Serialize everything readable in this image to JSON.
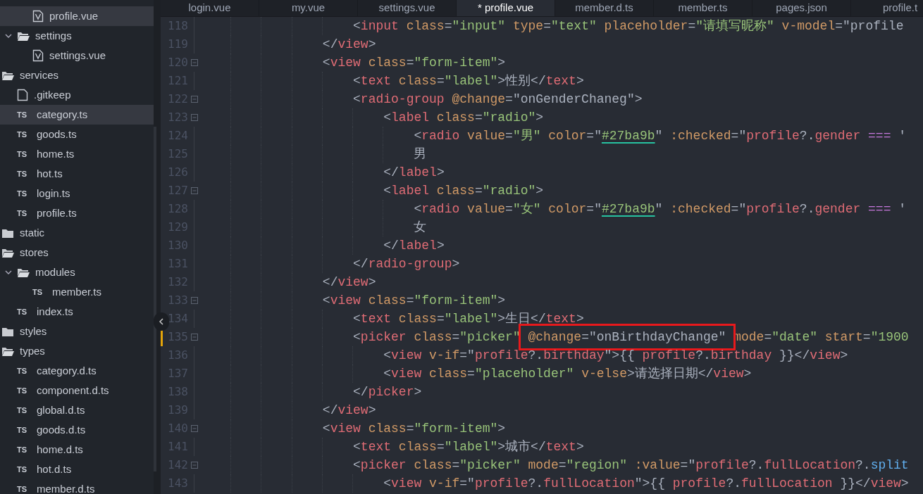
{
  "sidebar": {
    "tree": [
      {
        "kind": "folder",
        "children": [
          {
            "kind": "folder",
            "children": [
              {
                "kind": "vue",
                "name": "profile.vue",
                "selected": true
              }
            ]
          },
          {
            "kind": "folder",
            "name": "settings",
            "expanded": true,
            "children": [
              {
                "kind": "vue",
                "name": "settings.vue",
                "selected": false
              }
            ]
          }
        ]
      },
      {
        "kind": "folder",
        "name": "services",
        "expanded": true,
        "children": [
          {
            "kind": "file",
            "name": ".gitkeep",
            "selected": false
          },
          {
            "kind": "ts",
            "icon_label": "TS",
            "name": "category.ts",
            "selected": true
          },
          {
            "kind": "ts",
            "icon_label": "TS",
            "name": "goods.ts",
            "selected": false
          },
          {
            "kind": "ts",
            "icon_label": "TS",
            "name": "home.ts",
            "selected": false
          },
          {
            "kind": "ts",
            "icon_label": "TS",
            "name": "hot.ts",
            "selected": false
          },
          {
            "kind": "ts",
            "icon_label": "TS",
            "name": "login.ts",
            "selected": false
          },
          {
            "kind": "ts",
            "icon_label": "TS",
            "name": "profile.ts",
            "selected": false
          }
        ]
      },
      {
        "kind": "folder",
        "name": "static",
        "expanded": false
      },
      {
        "kind": "folder",
        "name": "stores",
        "expanded": true,
        "children": [
          {
            "kind": "folder",
            "name": "modules",
            "expanded": true,
            "children": [
              {
                "kind": "ts",
                "icon_label": "TS",
                "name": "member.ts",
                "selected": false
              }
            ]
          },
          {
            "kind": "ts",
            "icon_label": "TS",
            "name": "index.ts",
            "selected": false
          }
        ]
      },
      {
        "kind": "folder",
        "name": "styles",
        "expanded": false
      },
      {
        "kind": "folder",
        "name": "types",
        "expanded": true,
        "children": [
          {
            "kind": "ts",
            "icon_label": "TS",
            "name": "category.d.ts",
            "selected": false
          },
          {
            "kind": "ts",
            "icon_label": "TS",
            "name": "component.d.ts",
            "selected": false
          },
          {
            "kind": "ts",
            "icon_label": "TS",
            "name": "global.d.ts",
            "selected": false
          },
          {
            "kind": "ts",
            "icon_label": "TS",
            "name": "goods.d.ts",
            "selected": false
          },
          {
            "kind": "ts",
            "icon_label": "TS",
            "name": "home.d.ts",
            "selected": false
          },
          {
            "kind": "ts",
            "icon_label": "TS",
            "name": "hot.d.ts",
            "selected": false
          },
          {
            "kind": "ts",
            "icon_label": "TS",
            "name": "member.d.ts",
            "selected": false
          }
        ]
      }
    ]
  },
  "tabs": [
    {
      "label": "login.vue",
      "selected": false
    },
    {
      "label": "my.vue",
      "selected": false
    },
    {
      "label": "settings.vue",
      "selected": false
    },
    {
      "label": "* profile.vue",
      "selected": true
    },
    {
      "label": "member.d.ts",
      "selected": false
    },
    {
      "label": "member.ts",
      "selected": false
    },
    {
      "label": "pages.json",
      "selected": false
    },
    {
      "label": "profile.t",
      "selected": false
    }
  ],
  "editor": {
    "lines": [
      {
        "number": "118",
        "fold": false,
        "tokens": [
          {
            "kind": "p",
            "text": "                    <"
          },
          {
            "kind": "tag",
            "text": "input"
          },
          {
            "kind": "attr",
            "text": " class"
          },
          {
            "kind": "p",
            "text": "="
          },
          {
            "kind": "str",
            "text": "\"input\""
          },
          {
            "kind": "attr",
            "text": " type"
          },
          {
            "kind": "p",
            "text": "="
          },
          {
            "kind": "str",
            "text": "\"text\""
          },
          {
            "kind": "attr",
            "text": " placeholder"
          },
          {
            "kind": "p",
            "text": "="
          },
          {
            "kind": "str",
            "text": "\"请填写昵称\""
          },
          {
            "kind": "attr",
            "text": " v-model"
          },
          {
            "kind": "p",
            "text": "=\"profile"
          }
        ]
      },
      {
        "number": "119",
        "fold": false,
        "tokens": [
          {
            "kind": "p",
            "text": "                </"
          },
          {
            "kind": "tag",
            "text": "view"
          },
          {
            "kind": "p",
            "text": ">"
          }
        ]
      },
      {
        "number": "120",
        "fold": true,
        "tokens": [
          {
            "kind": "p",
            "text": "                <"
          },
          {
            "kind": "tag",
            "text": "view"
          },
          {
            "kind": "attr",
            "text": " class"
          },
          {
            "kind": "p",
            "text": "="
          },
          {
            "kind": "str",
            "text": "\"form-item\""
          },
          {
            "kind": "p",
            "text": ">"
          }
        ]
      },
      {
        "number": "121",
        "fold": false,
        "tokens": [
          {
            "kind": "p",
            "text": "                    <"
          },
          {
            "kind": "tag",
            "text": "text"
          },
          {
            "kind": "attr",
            "text": " class"
          },
          {
            "kind": "p",
            "text": "="
          },
          {
            "kind": "str",
            "text": "\"label\""
          },
          {
            "kind": "p",
            "text": ">性别</"
          },
          {
            "kind": "tag",
            "text": "text"
          },
          {
            "kind": "p",
            "text": ">"
          }
        ]
      },
      {
        "number": "122",
        "fold": true,
        "tokens": [
          {
            "kind": "p",
            "text": "                    <"
          },
          {
            "kind": "tag",
            "text": "radio-group"
          },
          {
            "kind": "attr",
            "text": " @change"
          },
          {
            "kind": "p",
            "text": "=\"onGenderChaneg\">"
          }
        ]
      },
      {
        "number": "123",
        "fold": true,
        "tokens": [
          {
            "kind": "p",
            "text": "                        <"
          },
          {
            "kind": "tag",
            "text": "label"
          },
          {
            "kind": "attr",
            "text": " class"
          },
          {
            "kind": "p",
            "text": "="
          },
          {
            "kind": "str",
            "text": "\"radio\""
          },
          {
            "kind": "p",
            "text": ">"
          }
        ]
      },
      {
        "number": "124",
        "fold": false,
        "tokens": [
          {
            "kind": "p",
            "text": "                            <"
          },
          {
            "kind": "tag",
            "text": "radio"
          },
          {
            "kind": "attr",
            "text": " value"
          },
          {
            "kind": "p",
            "text": "="
          },
          {
            "kind": "str",
            "text": "\"男\""
          },
          {
            "kind": "attr",
            "text": " color"
          },
          {
            "kind": "p",
            "text": "=\""
          },
          {
            "kind": "color",
            "text": "#27ba9b"
          },
          {
            "kind": "p",
            "text": "\""
          },
          {
            "kind": "attr",
            "text": " :checked"
          },
          {
            "kind": "p",
            "text": "=\""
          },
          {
            "kind": "var",
            "text": "profile"
          },
          {
            "kind": "p",
            "text": "?."
          },
          {
            "kind": "var",
            "text": "gender"
          },
          {
            "kind": "op",
            "text": " ==="
          },
          {
            "kind": "p",
            "text": " '"
          }
        ]
      },
      {
        "number": "125",
        "fold": false,
        "tokens": [
          {
            "kind": "p",
            "text": "                            男"
          }
        ]
      },
      {
        "number": "126",
        "fold": false,
        "tokens": [
          {
            "kind": "p",
            "text": "                        </"
          },
          {
            "kind": "tag",
            "text": "label"
          },
          {
            "kind": "p",
            "text": ">"
          }
        ]
      },
      {
        "number": "127",
        "fold": true,
        "tokens": [
          {
            "kind": "p",
            "text": "                        <"
          },
          {
            "kind": "tag",
            "text": "label"
          },
          {
            "kind": "attr",
            "text": " class"
          },
          {
            "kind": "p",
            "text": "="
          },
          {
            "kind": "str",
            "text": "\"radio\""
          },
          {
            "kind": "p",
            "text": ">"
          }
        ]
      },
      {
        "number": "128",
        "fold": false,
        "tokens": [
          {
            "kind": "p",
            "text": "                            <"
          },
          {
            "kind": "tag",
            "text": "radio"
          },
          {
            "kind": "attr",
            "text": " value"
          },
          {
            "kind": "p",
            "text": "="
          },
          {
            "kind": "str",
            "text": "\"女\""
          },
          {
            "kind": "attr",
            "text": " color"
          },
          {
            "kind": "p",
            "text": "=\""
          },
          {
            "kind": "color",
            "text": "#27ba9b"
          },
          {
            "kind": "p",
            "text": "\""
          },
          {
            "kind": "attr",
            "text": " :checked"
          },
          {
            "kind": "p",
            "text": "=\""
          },
          {
            "kind": "var",
            "text": "profile"
          },
          {
            "kind": "p",
            "text": "?."
          },
          {
            "kind": "var",
            "text": "gender"
          },
          {
            "kind": "op",
            "text": " ==="
          },
          {
            "kind": "p",
            "text": " '"
          }
        ]
      },
      {
        "number": "129",
        "fold": false,
        "tokens": [
          {
            "kind": "p",
            "text": "                            女"
          }
        ]
      },
      {
        "number": "130",
        "fold": false,
        "tokens": [
          {
            "kind": "p",
            "text": "                        </"
          },
          {
            "kind": "tag",
            "text": "label"
          },
          {
            "kind": "p",
            "text": ">"
          }
        ]
      },
      {
        "number": "131",
        "fold": false,
        "tokens": [
          {
            "kind": "p",
            "text": "                    </"
          },
          {
            "kind": "tag",
            "text": "radio-group"
          },
          {
            "kind": "p",
            "text": ">"
          }
        ]
      },
      {
        "number": "132",
        "fold": false,
        "tokens": [
          {
            "kind": "p",
            "text": "                </"
          },
          {
            "kind": "tag",
            "text": "view"
          },
          {
            "kind": "p",
            "text": ">"
          }
        ]
      },
      {
        "number": "133",
        "fold": true,
        "tokens": [
          {
            "kind": "p",
            "text": "                <"
          },
          {
            "kind": "tag",
            "text": "view"
          },
          {
            "kind": "attr",
            "text": " class"
          },
          {
            "kind": "p",
            "text": "="
          },
          {
            "kind": "str",
            "text": "\"form-item\""
          },
          {
            "kind": "p",
            "text": ">"
          }
        ]
      },
      {
        "number": "134",
        "fold": false,
        "tokens": [
          {
            "kind": "p",
            "text": "                    <"
          },
          {
            "kind": "tag",
            "text": "text"
          },
          {
            "kind": "attr",
            "text": " class"
          },
          {
            "kind": "p",
            "text": "="
          },
          {
            "kind": "str",
            "text": "\"label\""
          },
          {
            "kind": "p",
            "text": ">生日</"
          },
          {
            "kind": "tag",
            "text": "text"
          },
          {
            "kind": "p",
            "text": ">"
          }
        ]
      },
      {
        "number": "135",
        "fold": true,
        "modified": true,
        "tokens": [
          {
            "kind": "p",
            "text": "                    <"
          },
          {
            "kind": "tag",
            "text": "picker"
          },
          {
            "kind": "attr",
            "text": " class"
          },
          {
            "kind": "p",
            "text": "="
          },
          {
            "kind": "str",
            "text": "\"picker\" "
          }
        ],
        "boxed": [
          {
            "kind": "attr",
            "text": "@change"
          },
          {
            "kind": "p",
            "text": "=\"onBirthdayChange\""
          }
        ],
        "after": [
          {
            "kind": "attr",
            "text": " mode"
          },
          {
            "kind": "p",
            "text": "="
          },
          {
            "kind": "str",
            "text": "\"date\""
          },
          {
            "kind": "attr",
            "text": " start"
          },
          {
            "kind": "p",
            "text": "="
          },
          {
            "kind": "str",
            "text": "\"1900"
          }
        ]
      },
      {
        "number": "136",
        "fold": false,
        "tokens": [
          {
            "kind": "p",
            "text": "                        <"
          },
          {
            "kind": "tag",
            "text": "view"
          },
          {
            "kind": "attr",
            "text": " v-if"
          },
          {
            "kind": "p",
            "text": "=\""
          },
          {
            "kind": "var",
            "text": "profile"
          },
          {
            "kind": "p",
            "text": "?."
          },
          {
            "kind": "var",
            "text": "birthday"
          },
          {
            "kind": "p",
            "text": "\">{{ "
          },
          {
            "kind": "var",
            "text": "profile"
          },
          {
            "kind": "p",
            "text": "?."
          },
          {
            "kind": "var",
            "text": "birthday"
          },
          {
            "kind": "p",
            "text": " }}</"
          },
          {
            "kind": "tag",
            "text": "view"
          },
          {
            "kind": "p",
            "text": ">"
          }
        ]
      },
      {
        "number": "137",
        "fold": false,
        "tokens": [
          {
            "kind": "p",
            "text": "                        <"
          },
          {
            "kind": "tag",
            "text": "view"
          },
          {
            "kind": "attr",
            "text": " class"
          },
          {
            "kind": "p",
            "text": "="
          },
          {
            "kind": "str",
            "text": "\"placeholder\""
          },
          {
            "kind": "attr",
            "text": " v-else"
          },
          {
            "kind": "p",
            "text": ">请选择日期</"
          },
          {
            "kind": "tag",
            "text": "view"
          },
          {
            "kind": "p",
            "text": ">"
          }
        ]
      },
      {
        "number": "138",
        "fold": false,
        "tokens": [
          {
            "kind": "p",
            "text": "                    </"
          },
          {
            "kind": "tag",
            "text": "picker"
          },
          {
            "kind": "p",
            "text": ">"
          }
        ]
      },
      {
        "number": "139",
        "fold": false,
        "tokens": [
          {
            "kind": "p",
            "text": "                </"
          },
          {
            "kind": "tag",
            "text": "view"
          },
          {
            "kind": "p",
            "text": ">"
          }
        ]
      },
      {
        "number": "140",
        "fold": true,
        "tokens": [
          {
            "kind": "p",
            "text": "                <"
          },
          {
            "kind": "tag",
            "text": "view"
          },
          {
            "kind": "attr",
            "text": " class"
          },
          {
            "kind": "p",
            "text": "="
          },
          {
            "kind": "str",
            "text": "\"form-item\""
          },
          {
            "kind": "p",
            "text": ">"
          }
        ]
      },
      {
        "number": "141",
        "fold": false,
        "tokens": [
          {
            "kind": "p",
            "text": "                    <"
          },
          {
            "kind": "tag",
            "text": "text"
          },
          {
            "kind": "attr",
            "text": " class"
          },
          {
            "kind": "p",
            "text": "="
          },
          {
            "kind": "str",
            "text": "\"label\""
          },
          {
            "kind": "p",
            "text": ">城市</"
          },
          {
            "kind": "tag",
            "text": "text"
          },
          {
            "kind": "p",
            "text": ">"
          }
        ]
      },
      {
        "number": "142",
        "fold": true,
        "tokens": [
          {
            "kind": "p",
            "text": "                    <"
          },
          {
            "kind": "tag",
            "text": "picker"
          },
          {
            "kind": "attr",
            "text": " class"
          },
          {
            "kind": "p",
            "text": "="
          },
          {
            "kind": "str",
            "text": "\"picker\""
          },
          {
            "kind": "attr",
            "text": " mode"
          },
          {
            "kind": "p",
            "text": "="
          },
          {
            "kind": "str",
            "text": "\"region\""
          },
          {
            "kind": "attr",
            "text": " :value"
          },
          {
            "kind": "p",
            "text": "=\""
          },
          {
            "kind": "var",
            "text": "profile"
          },
          {
            "kind": "p",
            "text": "?."
          },
          {
            "kind": "var",
            "text": "fullLocation"
          },
          {
            "kind": "p",
            "text": "?."
          },
          {
            "kind": "fn",
            "text": "split"
          }
        ]
      },
      {
        "number": "143",
        "fold": false,
        "tokens": [
          {
            "kind": "p",
            "text": "                        <"
          },
          {
            "kind": "tag",
            "text": "view"
          },
          {
            "kind": "attr",
            "text": " v-if"
          },
          {
            "kind": "p",
            "text": "=\""
          },
          {
            "kind": "var",
            "text": "profile"
          },
          {
            "kind": "p",
            "text": "?."
          },
          {
            "kind": "var",
            "text": "fullLocation"
          },
          {
            "kind": "p",
            "text": "\">{{ "
          },
          {
            "kind": "var",
            "text": "profile"
          },
          {
            "kind": "p",
            "text": "?."
          },
          {
            "kind": "var",
            "text": "fullLocation"
          },
          {
            "kind": "p",
            "text": " }}</"
          },
          {
            "kind": "tag",
            "text": "view"
          },
          {
            "kind": "p",
            "text": ">"
          }
        ]
      }
    ]
  }
}
